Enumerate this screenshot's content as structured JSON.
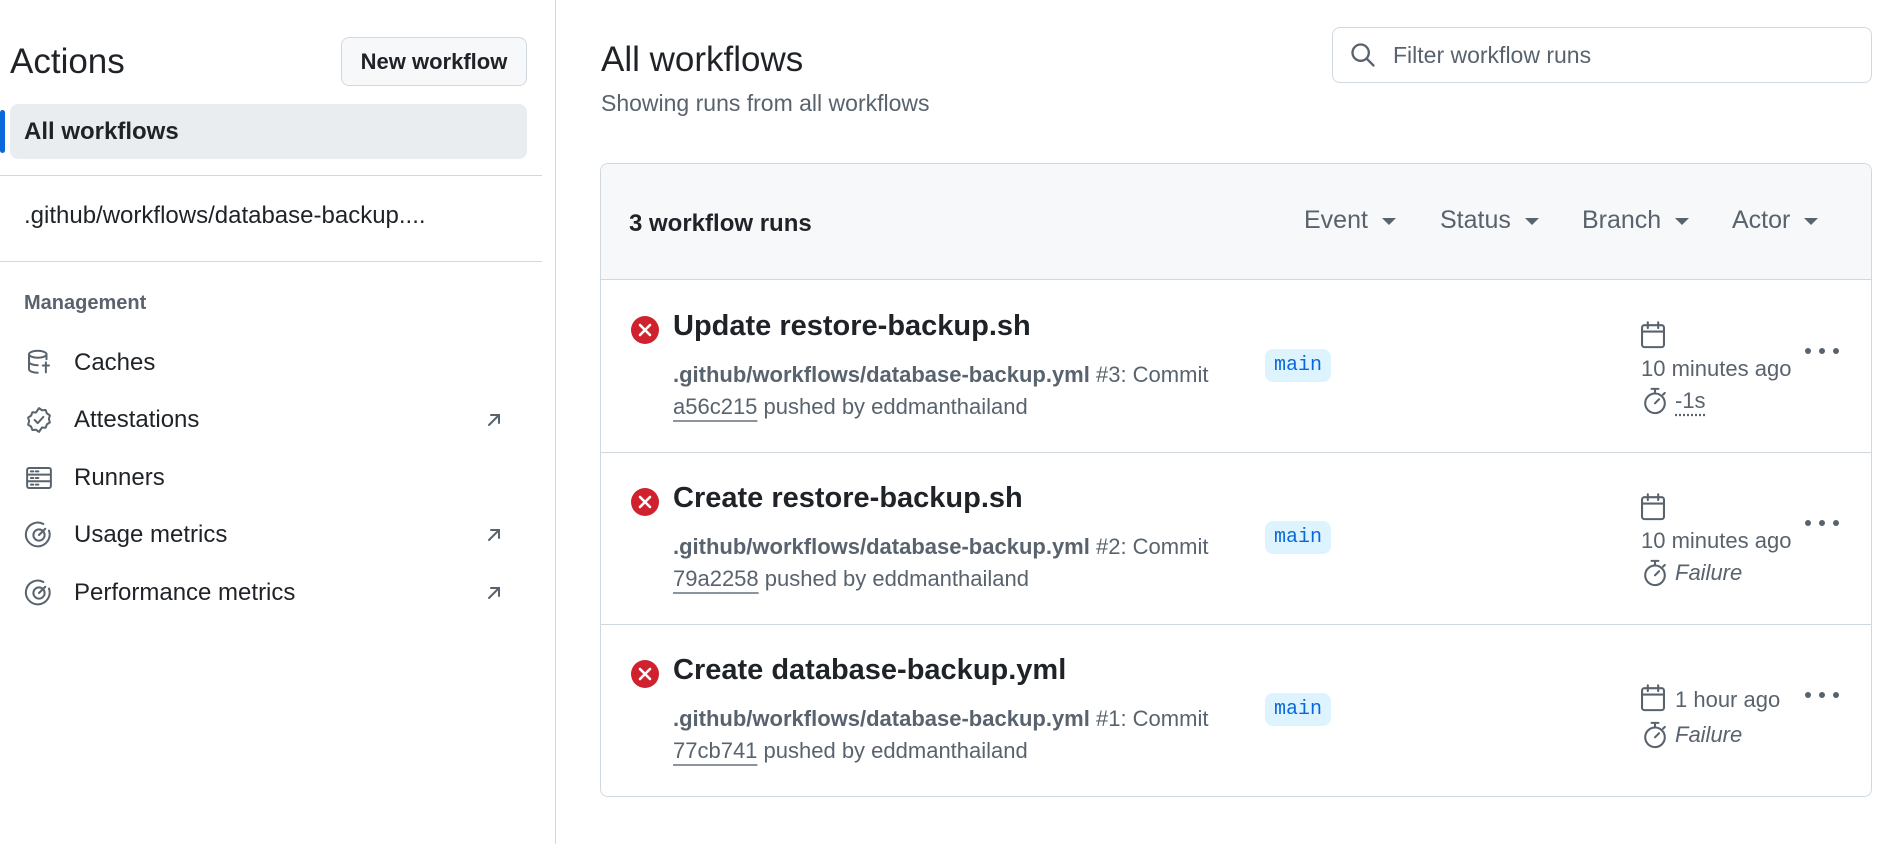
{
  "sidebar": {
    "title": "Actions",
    "new_workflow_label": "New workflow",
    "all_workflows_label": "All workflows",
    "workflow_files": [
      ".github/workflows/database-backup...."
    ],
    "management_label": "Management",
    "management_items": [
      {
        "label": "Caches",
        "icon": "database-icon",
        "external": false
      },
      {
        "label": "Attestations",
        "icon": "verified-icon",
        "external": true
      },
      {
        "label": "Runners",
        "icon": "server-icon",
        "external": false
      },
      {
        "label": "Usage metrics",
        "icon": "meter-icon",
        "external": true
      },
      {
        "label": "Performance metrics",
        "icon": "meter-icon",
        "external": true
      }
    ]
  },
  "main": {
    "title": "All workflows",
    "subtitle": "Showing runs from all workflows",
    "search_placeholder": "Filter workflow runs",
    "runs_count_label": "3 workflow runs",
    "filters": [
      "Event",
      "Status",
      "Branch",
      "Actor"
    ],
    "runs": [
      {
        "title": "Update restore-backup.sh",
        "workflow": ".github/workflows/database-backup.yml",
        "run_info": " #3: Commit",
        "sha": "a56c215",
        "pushed_by": " pushed by eddmanthailand",
        "branch": "main",
        "time": "10 minutes ago",
        "duration": "-1s",
        "status": "failure"
      },
      {
        "title": "Create restore-backup.sh",
        "workflow": ".github/workflows/database-backup.yml",
        "run_info": " #2: Commit",
        "sha": "79a2258",
        "pushed_by": " pushed by eddmanthailand",
        "branch": "main",
        "time": "10 minutes ago",
        "duration": "Failure",
        "status": "failure"
      },
      {
        "title": "Create database-backup.yml",
        "workflow": ".github/workflows/database-backup.yml",
        "run_info": " #1: Commit",
        "sha": "77cb741",
        "pushed_by": " pushed by eddmanthailand",
        "branch": "main",
        "time": "1 hour ago",
        "duration": "Failure",
        "status": "failure"
      }
    ]
  },
  "colors": {
    "accent": "#0969da",
    "failure": "#cf222e",
    "muted": "#59636e",
    "border": "#d1d9e0",
    "branch_bg": "#ddf4ff"
  }
}
